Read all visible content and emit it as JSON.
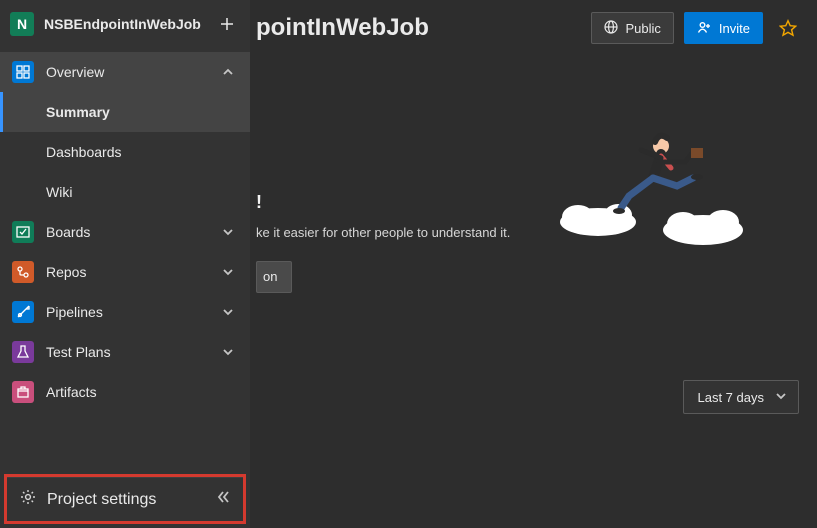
{
  "sidebar": {
    "project_initial": "N",
    "project_name": "NSBEndpointInWebJob",
    "nav": [
      {
        "label": "Overview",
        "expanded": true
      },
      {
        "label": "Boards"
      },
      {
        "label": "Repos"
      },
      {
        "label": "Pipelines"
      },
      {
        "label": "Test Plans"
      },
      {
        "label": "Artifacts"
      }
    ],
    "overview_children": [
      {
        "label": "Summary",
        "current": true
      },
      {
        "label": "Dashboards"
      },
      {
        "label": "Wiki"
      }
    ],
    "footer_label": "Project settings"
  },
  "header": {
    "page_title": "pointInWebJob",
    "public_label": "Public",
    "invite_label": "Invite"
  },
  "about": {
    "heading_fragment": "!",
    "desc_fragment": "ke it easier for other people to understand it.",
    "button_fragment": "on"
  },
  "stats": {
    "range_label": "Last 7 days"
  },
  "colors": {
    "brand_primary": "#0078d4",
    "sidebar_bg": "#333333",
    "content_bg": "#2d2d2d",
    "highlight": "#d43a2f",
    "star": "#f2a600"
  }
}
